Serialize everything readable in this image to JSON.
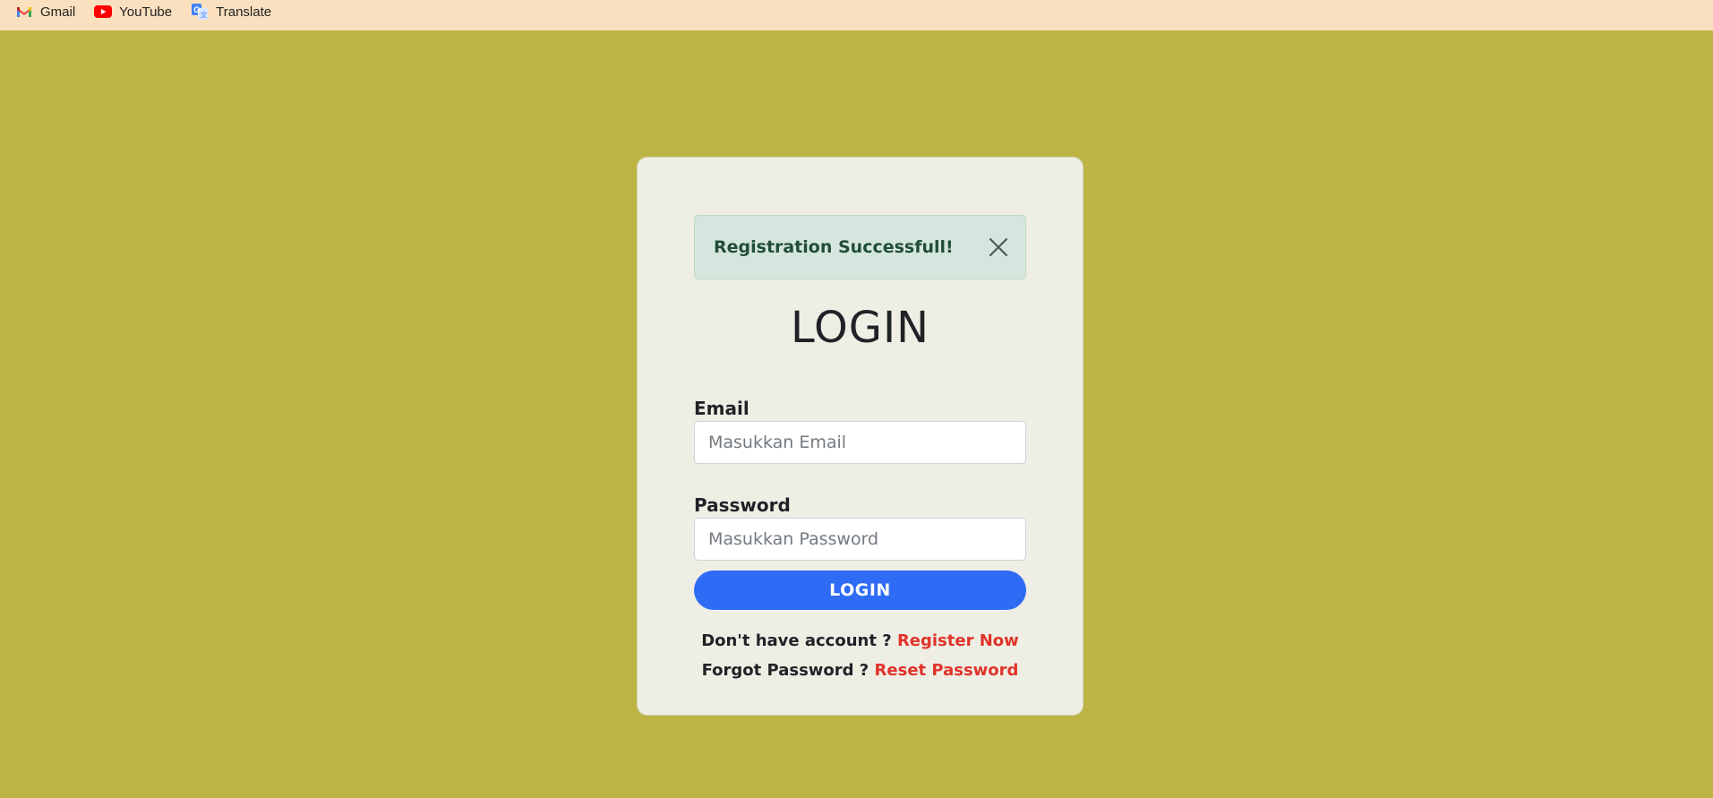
{
  "bookmarks": [
    {
      "label": "Gmail",
      "icon": "gmail-icon"
    },
    {
      "label": "YouTube",
      "icon": "youtube-icon"
    },
    {
      "label": "Translate",
      "icon": "translate-icon"
    }
  ],
  "alert": {
    "message": "Registration Successfull!",
    "close_icon": "close-icon"
  },
  "form": {
    "title": "LOGIN",
    "email_label": "Email",
    "email_placeholder": "Masukkan Email",
    "email_value": "",
    "password_label": "Password",
    "password_placeholder": "Masukkan Password",
    "password_value": "",
    "submit_label": "LOGIN"
  },
  "links": {
    "register_prompt": "Don't have account ?",
    "register_link": "Register Now",
    "forgot_prompt": "Forgot Password ?",
    "reset_link": "Reset Password"
  },
  "colors": {
    "page_background": "#bcb546",
    "bookmarks_bar": "#fbe0bf",
    "card_background": "#efeee4",
    "alert_background": "#d5e6de",
    "alert_text": "#214d37",
    "button": "#2f6cf5",
    "link": "#e0332a"
  }
}
